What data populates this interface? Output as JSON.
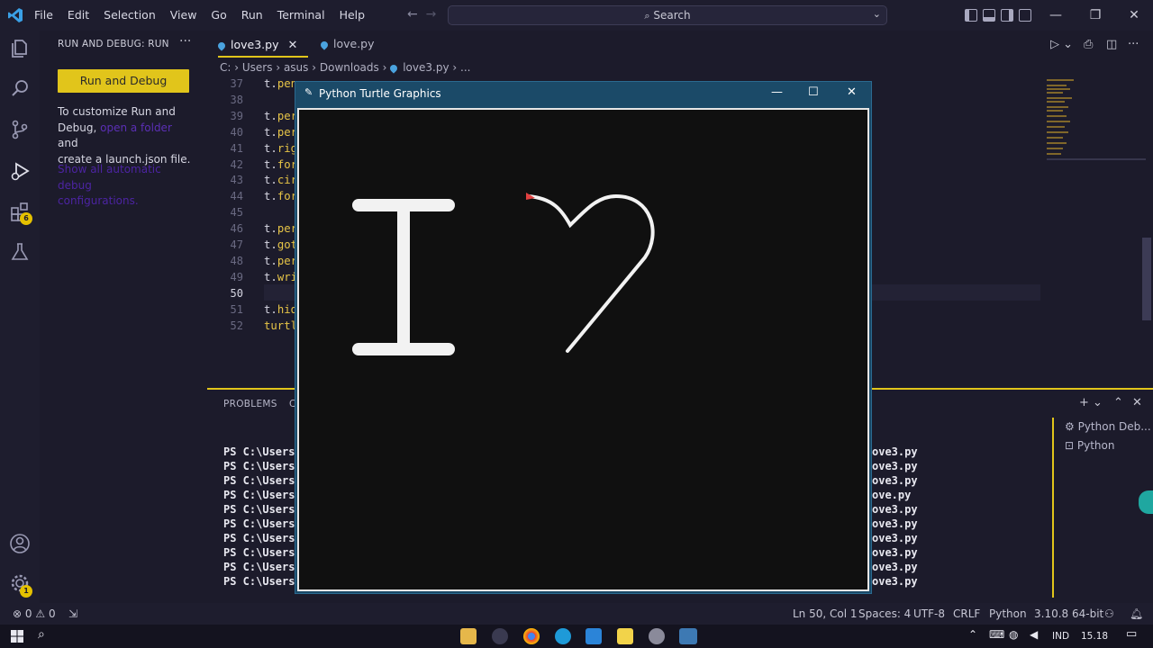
{
  "titlebar": {
    "menu": [
      "File",
      "Edit",
      "Selection",
      "View",
      "Go",
      "Run",
      "Terminal",
      "Help"
    ],
    "search_label": "Search"
  },
  "activity": {
    "extensions_badge": "6",
    "settings_badge": "1"
  },
  "sidebar": {
    "header": "RUN AND DEBUG: RUN",
    "run_button": "Run and Debug",
    "text1_a": "To customize Run and",
    "text1_b_pre": "Debug,",
    "text1_b_link": "open a folder",
    "text1_b_post": "and",
    "text1_c": "create a launch.json file.",
    "text2_a": "Show all automatic debug",
    "text2_b": "configurations."
  },
  "tabs": [
    {
      "label": "love3.py",
      "close": "✕"
    },
    {
      "label": "love.py"
    }
  ],
  "breadcrumb": {
    "parts": [
      "C:",
      "Users",
      "asus",
      "Downloads",
      "love3.py",
      "..."
    ]
  },
  "editor": {
    "lines": [
      {
        "n": "37",
        "obj": "t.",
        "rest": "pen"
      },
      {
        "n": "38",
        "obj": "",
        "rest": ""
      },
      {
        "n": "39",
        "obj": "t.",
        "rest": "per"
      },
      {
        "n": "40",
        "obj": "t.",
        "rest": "per"
      },
      {
        "n": "41",
        "obj": "t.",
        "rest": "rig"
      },
      {
        "n": "42",
        "obj": "t.",
        "rest": "for"
      },
      {
        "n": "43",
        "obj": "t.",
        "rest": "cir"
      },
      {
        "n": "44",
        "obj": "t.",
        "rest": "for"
      },
      {
        "n": "45",
        "obj": "",
        "rest": ""
      },
      {
        "n": "46",
        "obj": "t.",
        "rest": "per"
      },
      {
        "n": "47",
        "obj": "t.",
        "rest": "got"
      },
      {
        "n": "48",
        "obj": "t.",
        "rest": "per"
      },
      {
        "n": "49",
        "obj": "t.",
        "rest": "wri"
      },
      {
        "n": "50",
        "obj": "",
        "rest": ""
      },
      {
        "n": "51",
        "obj": "t.",
        "rest": "hid"
      },
      {
        "n": "52",
        "obj": "",
        "rest": "turtl"
      }
    ]
  },
  "panel": {
    "tab_problems": "PROBLEMS",
    "tab_output_partial": "C",
    "terminal_prefix": "PS C:\\Users\\",
    "terminal_suffixes": [
      "ove3.py",
      "ove3.py",
      "ove3.py",
      "ove.py",
      "ove3.py",
      "ove3.py",
      "ove3.py",
      "ove3.py",
      "ove3.py",
      "ove3.py"
    ],
    "terminals": [
      "Python Deb...",
      "Python"
    ]
  },
  "turtle_window": {
    "title": "Python Turtle Graphics",
    "minimize": "—",
    "maximize": "☐",
    "close": "✕"
  },
  "statusbar": {
    "errors": "0",
    "warnings": "0",
    "position": "Ln 50, Col 1",
    "spaces": "Spaces: 4",
    "encoding": "UTF-8",
    "eol": "CRLF",
    "language": "Python",
    "interpreter": "3.10.8 64-bit"
  },
  "taskbar": {
    "lang": "IND",
    "time": "15.18"
  },
  "colors": {
    "accent": "#e1c51b",
    "background": "#1c1b2b",
    "turtle_titlebar": "#1b4a68"
  }
}
